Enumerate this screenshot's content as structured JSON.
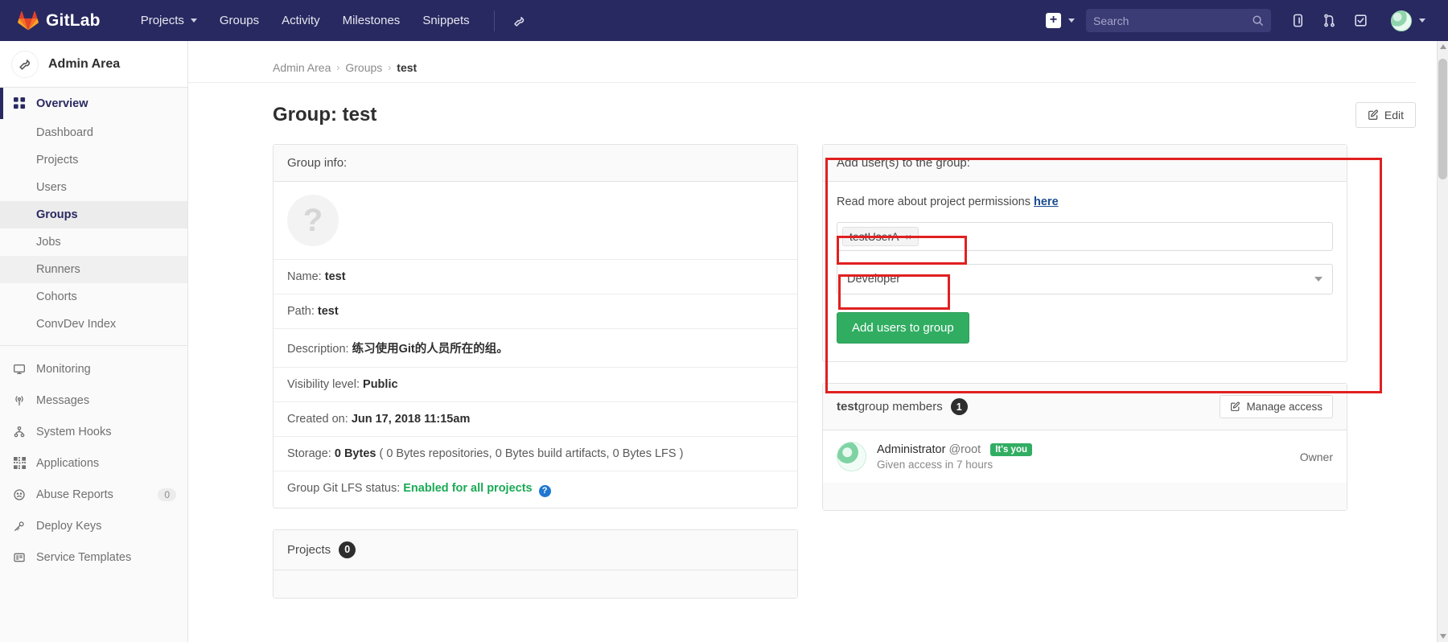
{
  "navbar": {
    "brand": "GitLab",
    "links": [
      {
        "label": "Projects",
        "has_caret": true
      },
      {
        "label": "Groups",
        "has_caret": false
      },
      {
        "label": "Activity",
        "has_caret": false
      },
      {
        "label": "Milestones",
        "has_caret": false
      },
      {
        "label": "Snippets",
        "has_caret": false
      }
    ],
    "wrench_icon": "wrench-icon",
    "plus_icon": "plus-icon",
    "search": {
      "value": "",
      "placeholder": "Search",
      "icon": "search-icon"
    },
    "icons": [
      {
        "name": "issues-icon"
      },
      {
        "name": "merge-requests-icon"
      },
      {
        "name": "todos-icon"
      }
    ],
    "avatar_icon": "user-avatar"
  },
  "sidebar": {
    "context_title": "Admin Area",
    "context_icon": "wrench-icon",
    "overview": {
      "label": "Overview",
      "icon": "grid-icon"
    },
    "sub_items": [
      {
        "label": "Dashboard",
        "state": "normal"
      },
      {
        "label": "Projects",
        "state": "normal"
      },
      {
        "label": "Users",
        "state": "normal"
      },
      {
        "label": "Groups",
        "state": "selected"
      },
      {
        "label": "Jobs",
        "state": "normal"
      },
      {
        "label": "Runners",
        "state": "hovered"
      },
      {
        "label": "Cohorts",
        "state": "normal"
      },
      {
        "label": "ConvDev Index",
        "state": "normal"
      }
    ],
    "bottom_items": [
      {
        "label": "Monitoring",
        "icon": "monitor-icon",
        "badge": ""
      },
      {
        "label": "Messages",
        "icon": "broadcast-icon",
        "badge": ""
      },
      {
        "label": "System Hooks",
        "icon": "hook-icon",
        "badge": ""
      },
      {
        "label": "Applications",
        "icon": "applications-icon",
        "badge": ""
      },
      {
        "label": "Abuse Reports",
        "icon": "abuse-icon",
        "badge": "0"
      },
      {
        "label": "Deploy Keys",
        "icon": "key-icon",
        "badge": ""
      },
      {
        "label": "Service Templates",
        "icon": "template-icon",
        "badge": ""
      }
    ]
  },
  "breadcrumb": {
    "items": [
      "Admin Area",
      "Groups"
    ],
    "current": "test",
    "separator": "›"
  },
  "page": {
    "title": "Group: test",
    "edit_label": "Edit",
    "edit_icon": "pencil-square-icon"
  },
  "group_info": {
    "header": "Group info:",
    "avatar_glyph": "?",
    "rows": [
      {
        "label": "Name:",
        "value": "test"
      },
      {
        "label": "Path:",
        "value": "test"
      },
      {
        "label": "Description:",
        "value": "练习使用Git的人员所在的组。"
      },
      {
        "label": "Visibility level:",
        "value": "Public"
      },
      {
        "label": "Created on:",
        "value": "Jun 17, 2018 11:15am"
      }
    ],
    "storage": {
      "label": "Storage:",
      "value": "0 Bytes",
      "detail": "( 0 Bytes repositories, 0 Bytes build artifacts, 0 Bytes LFS )"
    },
    "lfs": {
      "label": "Group Git LFS status:",
      "value": "Enabled for all projects",
      "help_icon": "question-circle-icon",
      "help_glyph": "?"
    }
  },
  "projects_panel": {
    "title": "Projects",
    "count": "0"
  },
  "add_users": {
    "header": "Add user(s) to the group:",
    "note_prefix": "Read more about project permissions ",
    "note_link": "here",
    "user_token": "testUserA",
    "token_remove_glyph": "×",
    "access_level": "Developer",
    "submit_label": "Add users to group"
  },
  "members_panel": {
    "title_bold": "test",
    "title_rest": " group members",
    "count": "1",
    "manage_label": "Manage access",
    "manage_icon": "pencil-square-icon",
    "member": {
      "name": "Administrator",
      "username": "@root",
      "you_tag": "It's you",
      "access_note": "Given access in 7 hours",
      "role": "Owner"
    }
  },
  "colors": {
    "navbar": "#292961",
    "accent": "#292961",
    "green": "#31ad62",
    "annotation_red": "#e02020",
    "link_blue": "#1a4c8f"
  }
}
